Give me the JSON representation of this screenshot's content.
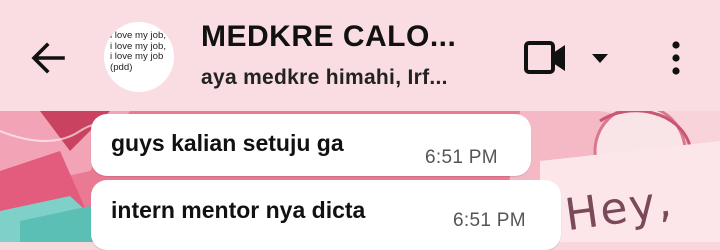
{
  "header": {
    "title": "MEDKRE CALO...",
    "subtitle": "aya medkre himahi, Irf...",
    "avatar_text": "i love my job,\ni love my job,\ni love my job\n(pdd)",
    "icons": {
      "back": "arrow-left-icon",
      "video": "video-camera-icon",
      "dropdown": "caret-down-icon",
      "menu": "more-vertical-icon"
    },
    "colors": {
      "header_bg": "#f9dde2",
      "text": "#111111"
    }
  },
  "wallpaper": {
    "text": "Hey,"
  },
  "messages": [
    {
      "text": "guys kalian setuju ga",
      "time": "6:51 PM"
    },
    {
      "text": "intern mentor nya dicta",
      "time": "6:51 PM"
    }
  ]
}
